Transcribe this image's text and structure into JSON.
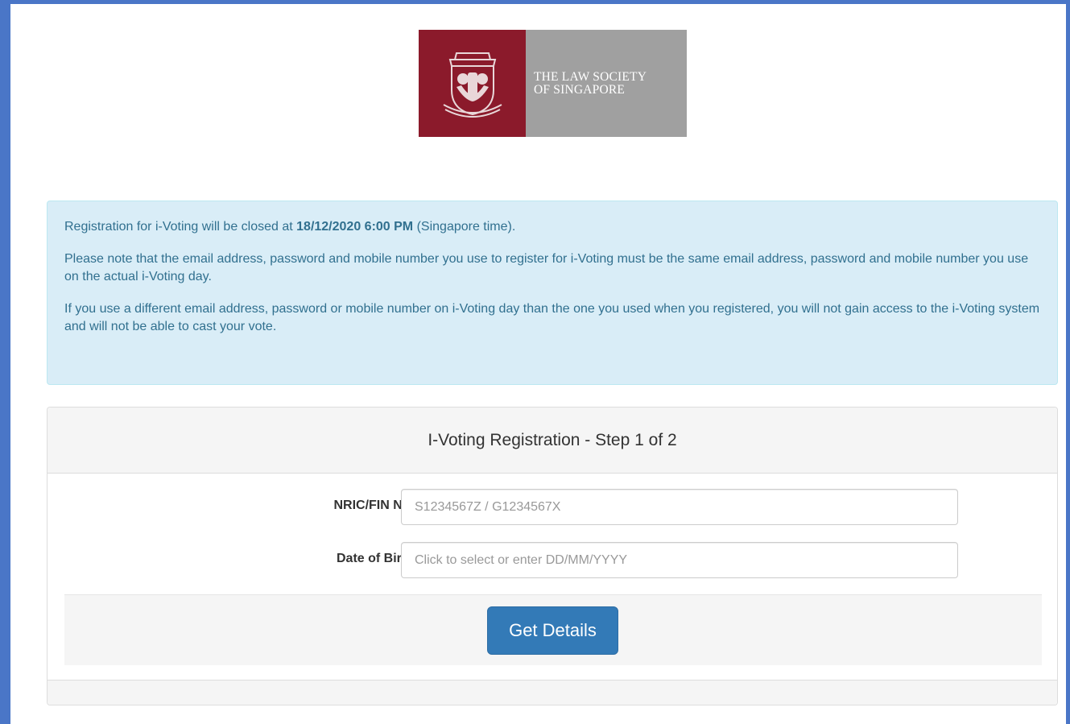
{
  "logo": {
    "line1": "THE LAW SOCIETY",
    "line2": "OF SINGAPORE",
    "seal_icon": "law-society-crest-icon",
    "colors": {
      "seal": "#8b1a2b",
      "text_bg": "#a0a0a0"
    }
  },
  "notice": {
    "p1_prefix": "Registration for i-Voting will be closed at ",
    "p1_bold": "18/12/2020 6:00 PM",
    "p1_suffix": " (Singapore time).",
    "p2": "Please note that the email address, password and mobile number you use to register for i-Voting must be the same email address, password and mobile number you use on the actual i-Voting day.",
    "p3": "If you use a different email address, password or mobile number on i-Voting day than the one you used when you registered, you will not gain access to the i-Voting system and will not be able to cast your vote."
  },
  "form": {
    "title": "I-Voting Registration - Step 1 of 2",
    "nric_label": "NRIC/FIN No.",
    "nric_placeholder": "S1234567Z / G1234567X",
    "nric_value": "",
    "dob_label": "Date of Birth",
    "dob_placeholder": "Click to select or enter DD/MM/YYYY",
    "dob_value": "",
    "submit_label": "Get Details"
  },
  "colors": {
    "frame": "#4a76c7",
    "alert_bg": "#d9edf7",
    "alert_text": "#31708f",
    "button": "#337ab7"
  }
}
